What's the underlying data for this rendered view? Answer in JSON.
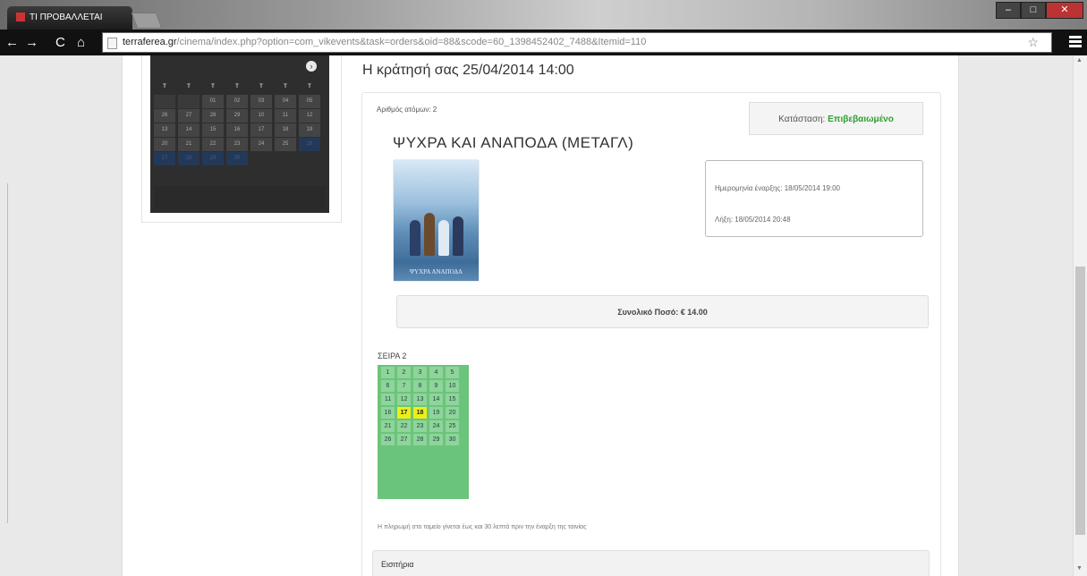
{
  "browser": {
    "tab_title": "ΤΙ ΠΡΟΒΑΛΛΕΤΑΙ",
    "url_host": "terraferea.gr",
    "url_path": "/cinema/index.php?option=com_vikevents&task=orders&oid=88&scode=60_1398452402_7488&Itemid=110"
  },
  "calendar": {
    "weekday_label": "Τ",
    "rows": [
      [
        "",
        "",
        "01",
        "02",
        "03",
        "04",
        "05"
      ],
      [
        "26",
        "27",
        "28",
        "29",
        "10",
        "11",
        "12"
      ],
      [
        "13",
        "14",
        "15",
        "16",
        "17",
        "18",
        "19"
      ],
      [
        "20",
        "21",
        "22",
        "23",
        "24",
        "25",
        "26"
      ],
      [
        "27",
        "28",
        "29",
        "30",
        "",
        "",
        ""
      ]
    ]
  },
  "booking": {
    "title": "Η κράτησή σας 25/04/2014 14:00",
    "seats_count": "Αριθμός ατόμων: 2",
    "status_label": "Κατάσταση:",
    "status_value": "Επιβεβαιωμένο",
    "movie_title": "ΨΥΧΡΑ ΚΑΙ ΑΝΑΠΟΔΑ (ΜΕΤΑΓΛ)",
    "poster_text": "ΨΥΧΡΑ ΑΝΑΠΟΔΑ",
    "start_date": "Ημερομηνία έναρξης: 18/05/2014 19:00",
    "end_date": "Λήξη: 18/05/2014 20:48",
    "total": "Συνολικό Ποσό: € 14.00",
    "row_label": "ΣΕΙΡΑ 2",
    "seat_rows": [
      [
        "1",
        "2",
        "3",
        "4",
        "5"
      ],
      [
        "6",
        "7",
        "8",
        "9",
        "10"
      ],
      [
        "11",
        "12",
        "13",
        "14",
        "15"
      ],
      [
        "16",
        "17",
        "18",
        "19",
        "20"
      ],
      [
        "21",
        "22",
        "23",
        "24",
        "25"
      ],
      [
        "26",
        "27",
        "28",
        "29",
        "30"
      ]
    ],
    "selected_seats": [
      "17",
      "18"
    ],
    "payment_note": "Η πληρωμή στο ταμείο γίνεται έως και 30 λεπτά πριν την έναρξη της ταινίας",
    "tickets_header": "Εισιτήρια"
  },
  "colors": {
    "status_green": "#2f9e2f",
    "seat_bg": "#8fd49b",
    "seat_selected": "#ecef16"
  }
}
